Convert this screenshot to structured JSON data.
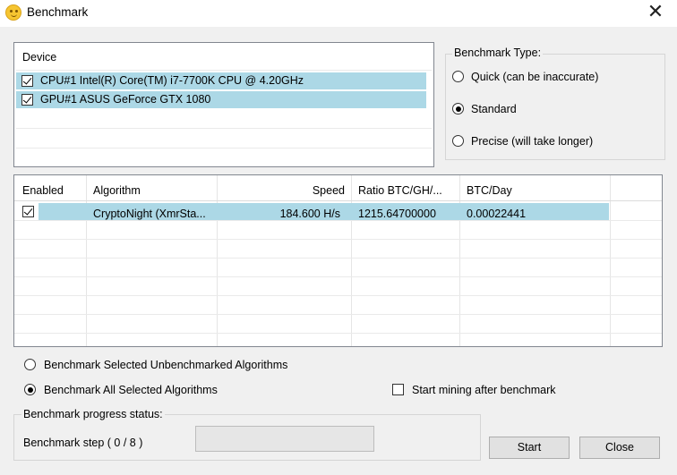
{
  "window": {
    "title": "Benchmark",
    "close_glyph": "✕"
  },
  "devices": {
    "header": "Device",
    "items": [
      {
        "label": "CPU#1 Intel(R) Core(TM) i7-7700K CPU @ 4.20GHz",
        "checked": true
      },
      {
        "label": "GPU#1 ASUS GeForce GTX 1080",
        "checked": true
      }
    ]
  },
  "benchmark_type": {
    "legend": "Benchmark Type:",
    "options": [
      {
        "label": "Quick (can be inaccurate)",
        "selected": false
      },
      {
        "label": "Standard",
        "selected": true
      },
      {
        "label": "Precise (will take longer)",
        "selected": false
      }
    ]
  },
  "algorithms": {
    "columns": [
      "Enabled",
      "Algorithm",
      "Speed",
      "Ratio BTC/GH/...",
      "BTC/Day"
    ],
    "rows": [
      {
        "enabled": true,
        "algorithm": "CryptoNight (XmrSta...",
        "speed": "184.600 H/s",
        "ratio": "1215.64700000",
        "btc_day": "0.00022441"
      }
    ]
  },
  "scope": {
    "options": [
      {
        "label": "Benchmark Selected Unbenchmarked Algorithms",
        "selected": false
      },
      {
        "label": "Benchmark All Selected Algorithms",
        "selected": true
      }
    ]
  },
  "start_mining": {
    "label": "Start mining after benchmark",
    "checked": false
  },
  "progress": {
    "legend": "Benchmark progress status:",
    "step_text": "Benchmark step ( 0 / 8 )",
    "fraction": 0
  },
  "buttons": {
    "start": "Start",
    "close": "Close"
  },
  "colors": {
    "selection": "#acd8e6",
    "window_bg": "#f0f0f0"
  }
}
